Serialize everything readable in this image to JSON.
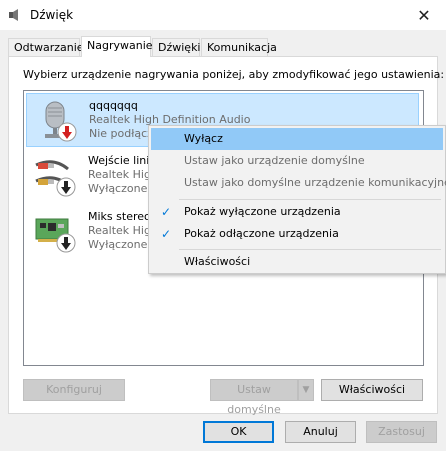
{
  "window": {
    "title": "Dźwięk",
    "close_glyph": "✕"
  },
  "tabs": [
    {
      "label": "Odtwarzanie"
    },
    {
      "label": "Nagrywanie",
      "active": true
    },
    {
      "label": "Dźwięki"
    },
    {
      "label": "Komunikacja"
    }
  ],
  "instruction": "Wybierz urządzenie nagrywania poniżej, aby zmodyfikować jego ustawienia:",
  "devices": [
    {
      "name": "qqqqqqq",
      "driver": "Realtek High Definition Audio",
      "status": "Nie podłącz",
      "icon": "microphone-icon",
      "badge": "red-down-arrow-badge",
      "selected": true
    },
    {
      "name": "Wejście lini",
      "driver": "Realtek High",
      "status": "Wyłączone,",
      "icon": "line-in-cable-icon",
      "badge": "black-down-arrow-badge"
    },
    {
      "name": "Miks stereo",
      "driver": "Realtek High",
      "status": "Wyłączone",
      "icon": "sound-card-icon",
      "badge": "black-down-arrow-badge"
    }
  ],
  "context_menu": {
    "items": [
      {
        "label": "Wyłącz",
        "state": "hover"
      },
      {
        "label": "Ustaw jako urządzenie domyślne",
        "state": "disabled"
      },
      {
        "label": "Ustaw jako domyślne urządzenie komunikacyjne",
        "state": "disabled"
      },
      {
        "label": "Pokaż wyłączone urządzenia",
        "checked": true
      },
      {
        "label": "Pokaż odłączone urządzenia",
        "checked": true
      },
      {
        "label": "Właściwości"
      }
    ],
    "check_glyph": "✓"
  },
  "panel_buttons": {
    "configure": "Konfiguruj",
    "set_default": "Ustaw domyślne",
    "properties": "Właściwości"
  },
  "dialog_buttons": {
    "ok": "OK",
    "cancel": "Anuluj",
    "apply": "Zastosuj"
  },
  "colors": {
    "selection": "#cce8ff",
    "menu_hover": "#91c9f7",
    "accent": "#0078d7"
  }
}
